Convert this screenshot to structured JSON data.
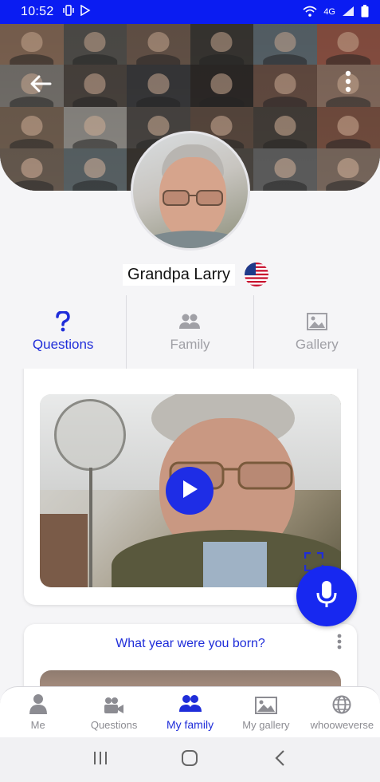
{
  "status_bar": {
    "time": "10:52",
    "network": "4G"
  },
  "header": {
    "back_icon": "arrow-left-icon",
    "more_icon": "more-vertical-icon"
  },
  "profile": {
    "name": "Grandpa Larry",
    "flag_icon": "us-flag-icon"
  },
  "tabs": [
    {
      "label": "Questions",
      "icon": "question-mark-icon",
      "active": true
    },
    {
      "label": "Family",
      "icon": "people-icon",
      "active": false
    },
    {
      "label": "Gallery",
      "icon": "image-icon",
      "active": false
    }
  ],
  "cards": [
    {
      "video": {
        "play_icon": "play-icon",
        "fullscreen_icon": "fullscreen-icon"
      }
    },
    {
      "question": "What year were you born?",
      "more_icon": "more-vertical-icon"
    }
  ],
  "mic_button": {
    "icon": "microphone-icon"
  },
  "bottom_nav": [
    {
      "label": "Me",
      "icon": "person-icon",
      "active": false
    },
    {
      "label": "Questions",
      "icon": "video-camera-icon",
      "active": false
    },
    {
      "label": "My family",
      "icon": "people-icon",
      "active": true
    },
    {
      "label": "My gallery",
      "icon": "image-icon",
      "active": false
    },
    {
      "label": "whooweverse",
      "icon": "globe-icon",
      "active": false
    }
  ],
  "system_nav": [
    "recent-apps-icon",
    "home-icon",
    "back-icon"
  ],
  "colors": {
    "accent": "#1f2dd9",
    "status_bar": "#0a1cf2",
    "inactive": "#a0a0a6"
  }
}
